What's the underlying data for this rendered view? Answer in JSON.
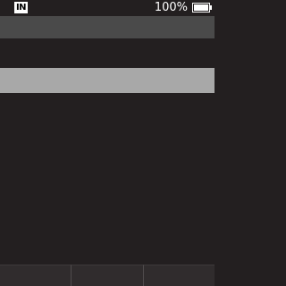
{
  "status_bar": {
    "input_mode": "IN",
    "battery_percent": "100%",
    "battery_icon": "battery-full-icon"
  },
  "header": {
    "title": ""
  },
  "list": {
    "selected_label": ""
  },
  "softkeys": {
    "left": "",
    "center": "",
    "right": ""
  },
  "colors": {
    "background": "#231f20",
    "header": "#4a4a4a",
    "selection": "#a8a8a8",
    "softkey": "#302c2d",
    "text": "#ffffff"
  }
}
